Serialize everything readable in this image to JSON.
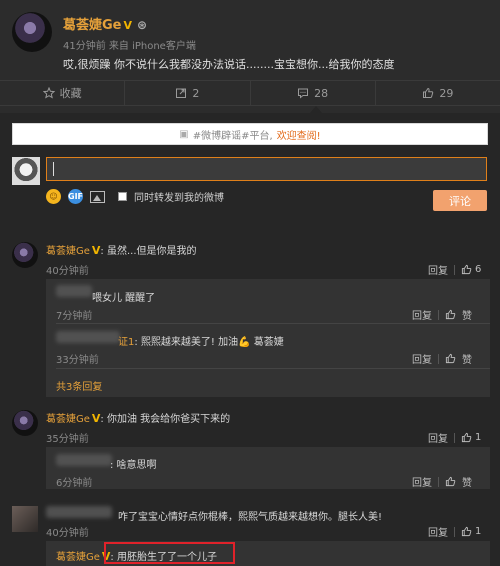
{
  "post": {
    "author": "葛荟婕Ge",
    "time_source": "41分钟前 来自 iPhone客户端",
    "content": "哎,很烦躁 你不说什么我都没办法说话........宝宝想你...给我你的态度"
  },
  "actions": {
    "favorite": "收藏",
    "repost": "2",
    "comment": "28",
    "like": "29"
  },
  "notice": {
    "prefix": "#微博辟谣#平台,",
    "link": "欢迎查阅!"
  },
  "composer": {
    "also_repost": "同时转发到我的微博",
    "submit": "评论"
  },
  "comments": [
    {
      "name": "葛荟婕Ge",
      "text": ": 虽然...但是你是我的",
      "time": "40分钟前",
      "reply": "回复",
      "likes": "6",
      "replies": [
        {
          "name": "",
          "text": "喂女儿 醒醒了",
          "time": "7分钟前",
          "reply": "回复",
          "like": "赞"
        },
        {
          "name": "证1",
          "text": ": 熙熙越来越美了! 加油💪 葛荟婕",
          "time": "33分钟前",
          "reply": "回复",
          "like": "赞"
        }
      ],
      "more": "共3条回复"
    },
    {
      "name": "葛荟婕Ge",
      "text": ": 你加油 我会给你爸买下来的",
      "time": "35分钟前",
      "reply": "回复",
      "likes": "1",
      "replies": [
        {
          "name": "",
          "text": ": 啥意思啊",
          "time": "6分钟前",
          "reply": "回复",
          "like": "赞"
        }
      ]
    },
    {
      "name": "",
      "text": "咋了宝宝心情好点你棍棒，熙熙气质越来越想你。腿长人美!",
      "time": "40分钟前",
      "reply": "回复",
      "likes": "1",
      "replies": [
        {
          "name": "葛荟婕Ge",
          "text": ": 用胚胎生了了一个儿子"
        }
      ]
    }
  ],
  "colors": {
    "accent": "#e6a13a",
    "button": "#f2a26e",
    "highlight": "#e0222a"
  }
}
